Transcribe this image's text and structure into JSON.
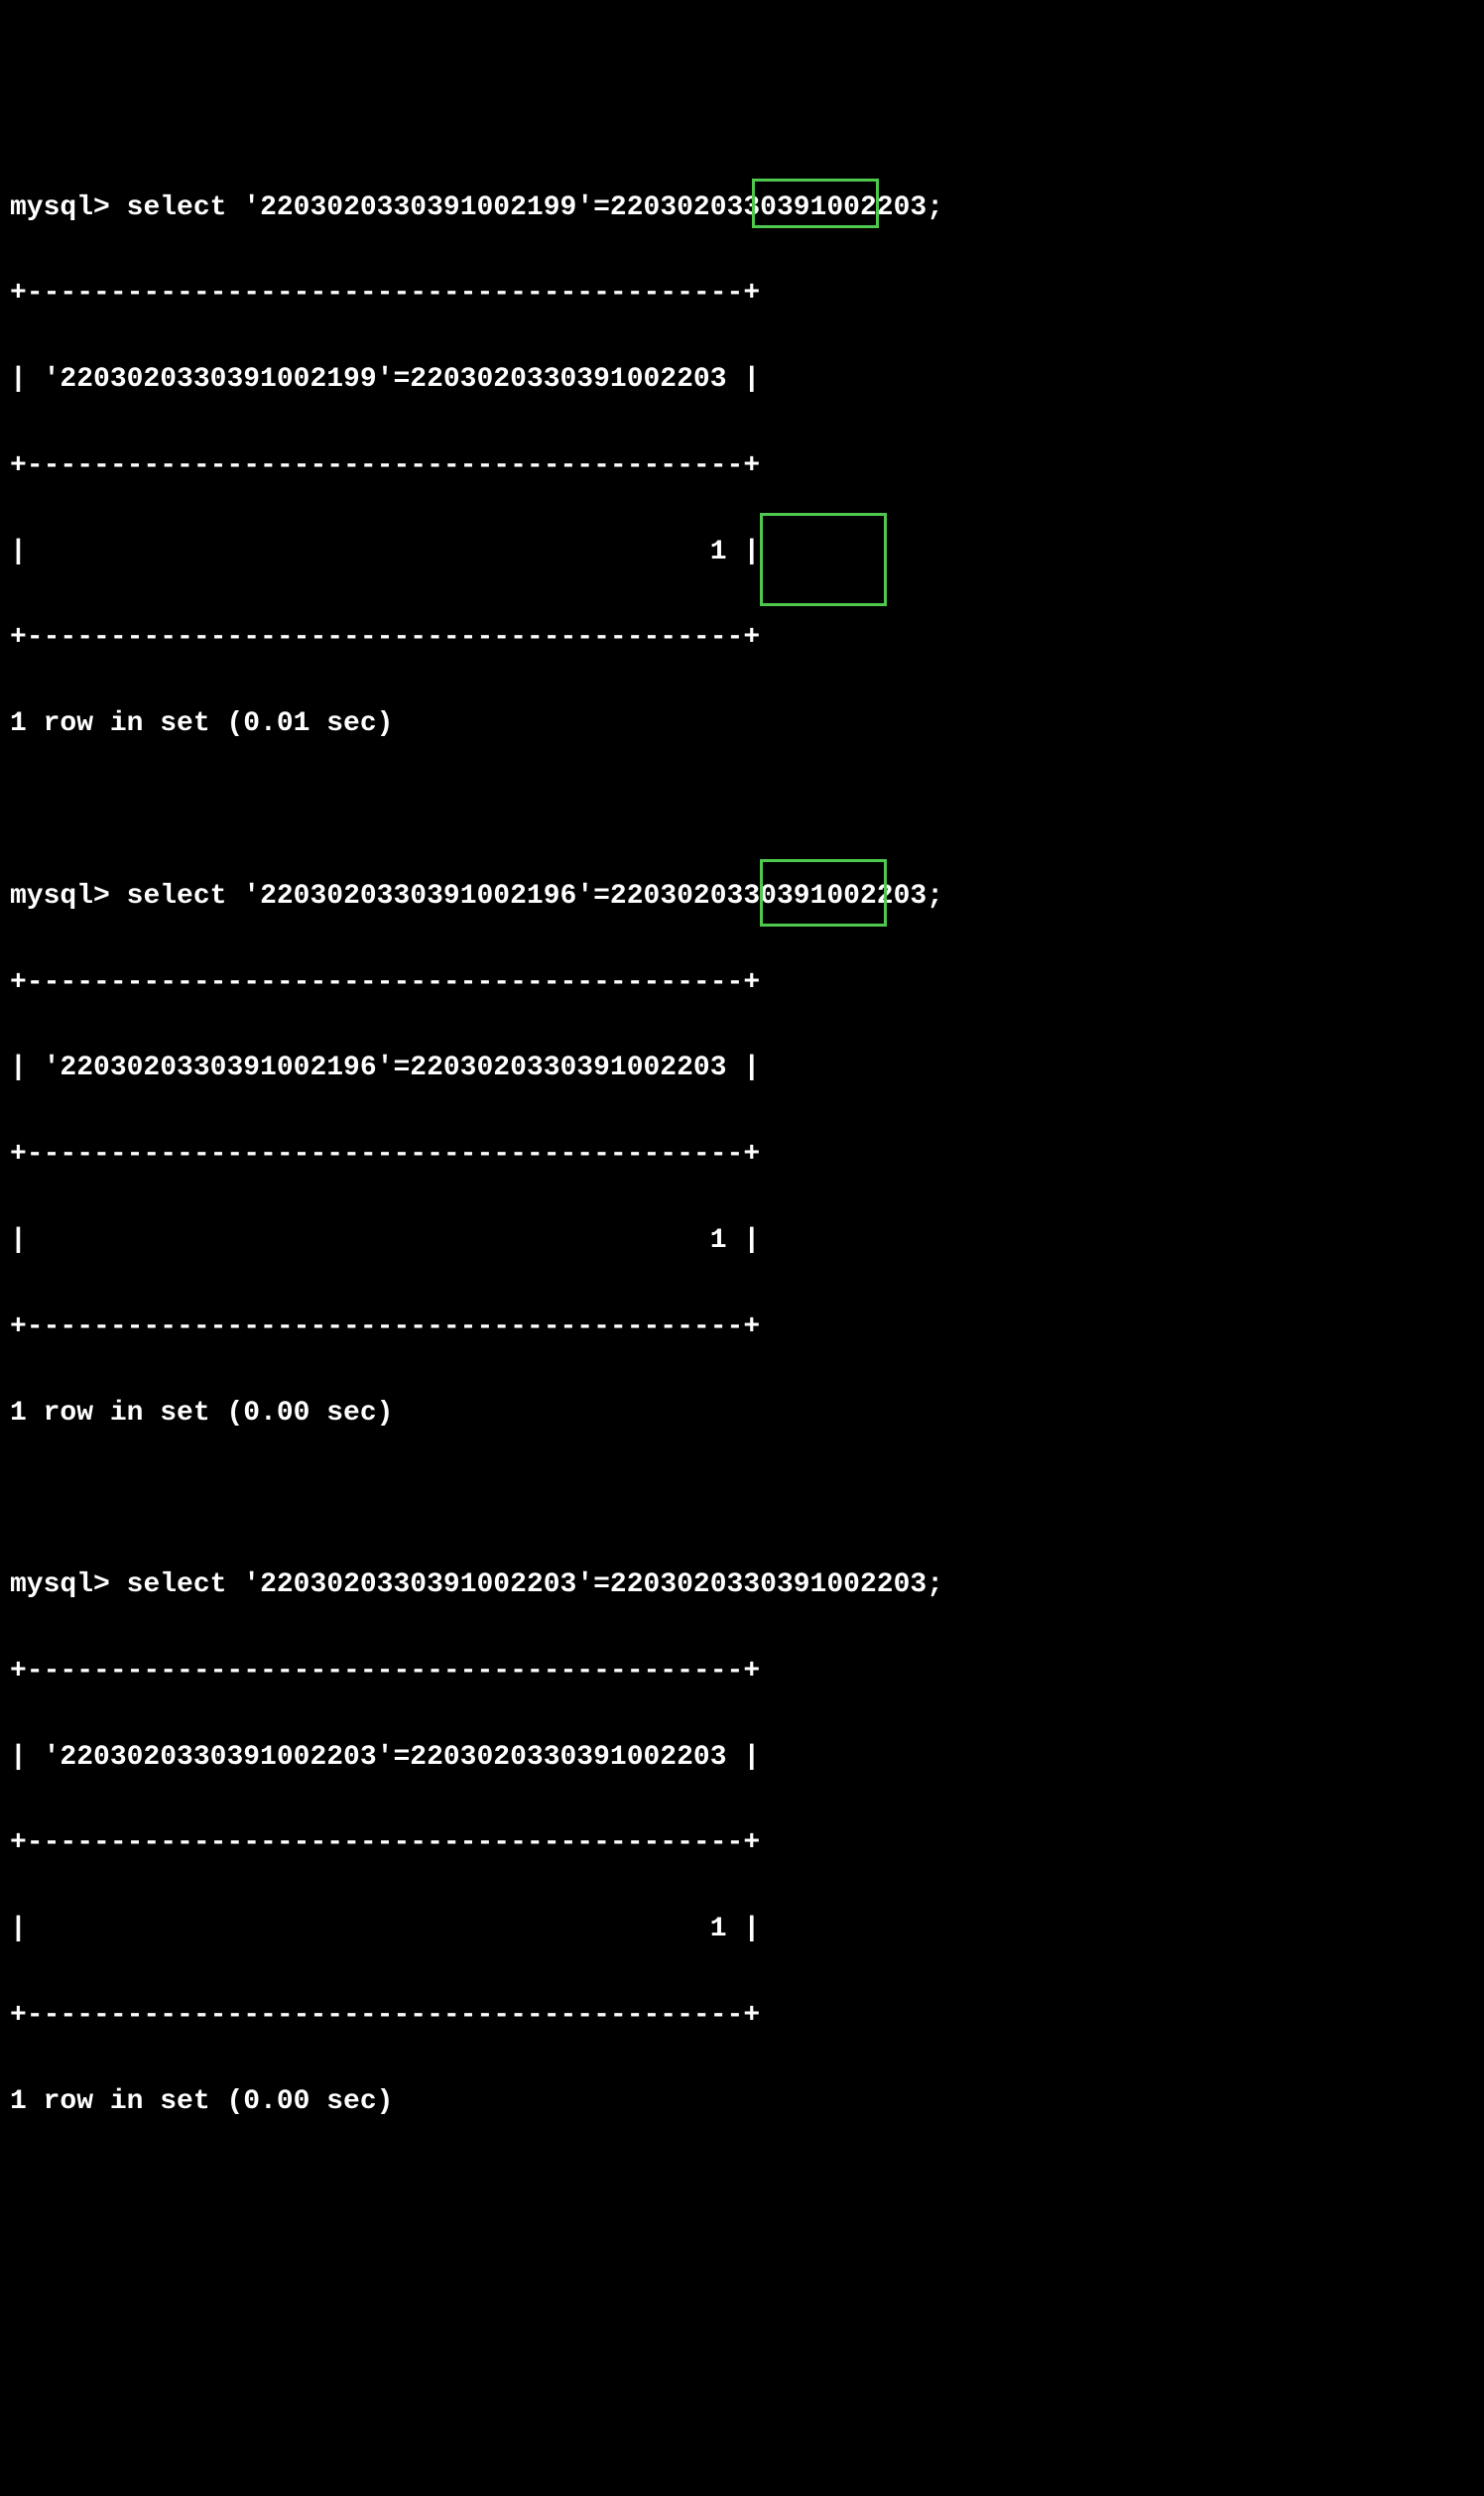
{
  "prompt": "mysql>",
  "queries": [
    {
      "query": "select '2203020330391002199'=2203020330391002203;",
      "header": "'2203020330391002199'=2203020330391002203",
      "result": "1",
      "footer": "1 row in set (0.01 sec)"
    },
    {
      "query": "select '2203020330391002196'=2203020330391002203;",
      "header": "'2203020330391002196'=2203020330391002203",
      "result": "1",
      "footer": "1 row in set (0.00 sec)"
    },
    {
      "query": "select '2203020330391002203'=2203020330391002203;",
      "header": "'2203020330391002203'=2203020330391002203",
      "result": "1",
      "footer": "1 row in set (0.00 sec)"
    }
  ],
  "border": "+-------------------------------------------+"
}
